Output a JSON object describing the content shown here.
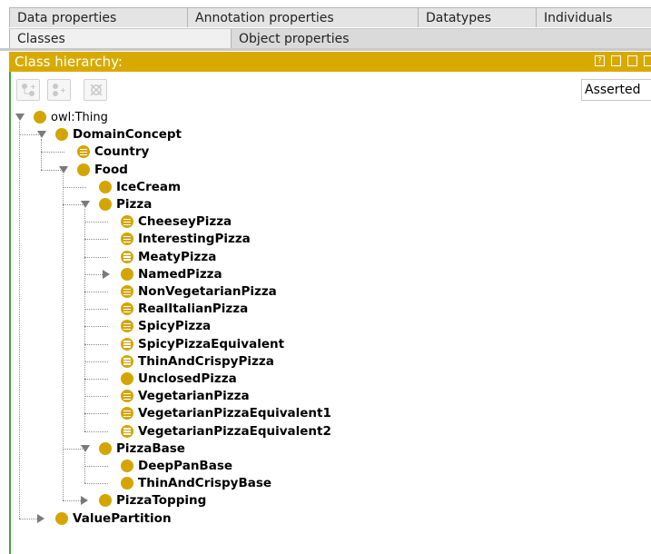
{
  "tabs": {
    "row1": [
      "Data properties",
      "Annotation properties",
      "Datatypes",
      "Individuals"
    ],
    "row2": [
      "Classes",
      "Object properties"
    ]
  },
  "hierarchy": {
    "title": "Class hierarchy:",
    "mode": "Asserted",
    "accent": "#d8aa00"
  },
  "tree": [
    {
      "label": "owl:Thing",
      "level": 0,
      "toggle": "expanded",
      "defined": false
    },
    {
      "label": "DomainConcept",
      "level": 1,
      "toggle": "expanded",
      "defined": false
    },
    {
      "label": "Country",
      "level": 2,
      "toggle": "none",
      "defined": true
    },
    {
      "label": "Food",
      "level": 2,
      "toggle": "expanded",
      "defined": false
    },
    {
      "label": "IceCream",
      "level": 3,
      "toggle": "none",
      "defined": false
    },
    {
      "label": "Pizza",
      "level": 3,
      "toggle": "expanded",
      "defined": false
    },
    {
      "label": "CheeseyPizza",
      "level": 4,
      "toggle": "none",
      "defined": true
    },
    {
      "label": "InterestingPizza",
      "level": 4,
      "toggle": "none",
      "defined": true
    },
    {
      "label": "MeatyPizza",
      "level": 4,
      "toggle": "none",
      "defined": true
    },
    {
      "label": "NamedPizza",
      "level": 4,
      "toggle": "collapsed",
      "defined": false
    },
    {
      "label": "NonVegetarianPizza",
      "level": 4,
      "toggle": "none",
      "defined": true
    },
    {
      "label": "RealItalianPizza",
      "level": 4,
      "toggle": "none",
      "defined": true
    },
    {
      "label": "SpicyPizza",
      "level": 4,
      "toggle": "none",
      "defined": true
    },
    {
      "label": "SpicyPizzaEquivalent",
      "level": 4,
      "toggle": "none",
      "defined": true
    },
    {
      "label": "ThinAndCrispyPizza",
      "level": 4,
      "toggle": "none",
      "defined": true
    },
    {
      "label": "UnclosedPizza",
      "level": 4,
      "toggle": "none",
      "defined": false
    },
    {
      "label": "VegetarianPizza",
      "level": 4,
      "toggle": "none",
      "defined": true
    },
    {
      "label": "VegetarianPizzaEquivalent1",
      "level": 4,
      "toggle": "none",
      "defined": true
    },
    {
      "label": "VegetarianPizzaEquivalent2",
      "level": 4,
      "toggle": "none",
      "defined": true
    },
    {
      "label": "PizzaBase",
      "level": 3,
      "toggle": "expanded",
      "defined": false
    },
    {
      "label": "DeepPanBase",
      "level": 4,
      "toggle": "none",
      "defined": false
    },
    {
      "label": "ThinAndCrispyBase",
      "level": 4,
      "toggle": "none",
      "defined": false
    },
    {
      "label": "PizzaTopping",
      "level": 3,
      "toggle": "collapsed",
      "defined": false
    },
    {
      "label": "ValuePartition",
      "level": 1,
      "toggle": "collapsed",
      "defined": false
    }
  ]
}
